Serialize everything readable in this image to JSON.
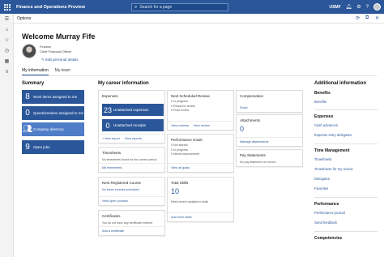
{
  "app": {
    "title": "Finance and Operations Preview",
    "company": "USMF"
  },
  "search": {
    "placeholder": "Search for a page"
  },
  "actionbar": {
    "options_label": "Options"
  },
  "header": {
    "welcome": "Welcome Murray Fife",
    "department": "Finance",
    "job_title": "Chief Financial Officer",
    "edit_link": "Edit personal details"
  },
  "tabs": [
    "My information",
    "My team"
  ],
  "summary": {
    "title": "Summary",
    "tiles": [
      {
        "value": "8",
        "label": "Work items assigned to me"
      },
      {
        "value": "0",
        "label": "Questionnaires assigned to me"
      },
      {
        "value": "",
        "label": "Company directory"
      },
      {
        "value": "9",
        "label": "Open jobs"
      }
    ]
  },
  "career": {
    "title": "My career information",
    "expenses": {
      "title": "Expenses",
      "tiles": [
        {
          "value": "23",
          "label": "Unattached expenses"
        },
        {
          "value": "0",
          "label": "Unattached receipts"
        }
      ],
      "links": [
        "+ New report",
        "View reports"
      ]
    },
    "next_review": {
      "title": "Next Scheduled Review",
      "lines": [
        "0 In progress",
        "0 Ready for review",
        "0 Final review"
      ],
      "links": [
        "View reviews",
        "New review"
      ]
    },
    "compensation": {
      "title": "Compensation",
      "link": "Show"
    },
    "attachments": {
      "title": "Attachments",
      "value": "0",
      "link": "Manage attachments"
    },
    "timesheets": {
      "title": "Timesheets",
      "note": "No timesheets found for the current period",
      "link": "My timesheets"
    },
    "performance_goals": {
      "title": "Performance Goals",
      "lines": [
        "0 Not started",
        "0 In progress",
        "0 Needs improvement"
      ],
      "link": "View all goals"
    },
    "pay_statements": {
      "title": "Pay Statements",
      "note": "No pay statement on record"
    },
    "next_course": {
      "title": "Next Registered Course",
      "note": "No future courses scheduled",
      "link": "View open courses"
    },
    "total_skills": {
      "title": "Total Skills",
      "value": "10",
      "note": "Need recent updates to skills",
      "link": "Add more skills"
    },
    "certificates": {
      "title": "Certificates",
      "note": "You do not have any certificate entered",
      "link": "Add a certificate"
    }
  },
  "additional": {
    "title": "Additional information",
    "sections": [
      {
        "title": "Benefits",
        "links": [
          "Benefits"
        ]
      },
      {
        "title": "Expenses",
        "links": [
          "Cash advances",
          "Expense entry delegates"
        ]
      },
      {
        "title": "Time Management",
        "links": [
          "Timesheets",
          "Timesheets for my review",
          "Delegates",
          "Favorites"
        ]
      },
      {
        "title": "Performance",
        "links": [
          "Performance journal",
          "Send feedback"
        ]
      },
      {
        "title": "Competencies",
        "links": []
      }
    ]
  },
  "colors": {
    "brand": "#2b579a",
    "tile_light": "#4f7dc7"
  }
}
